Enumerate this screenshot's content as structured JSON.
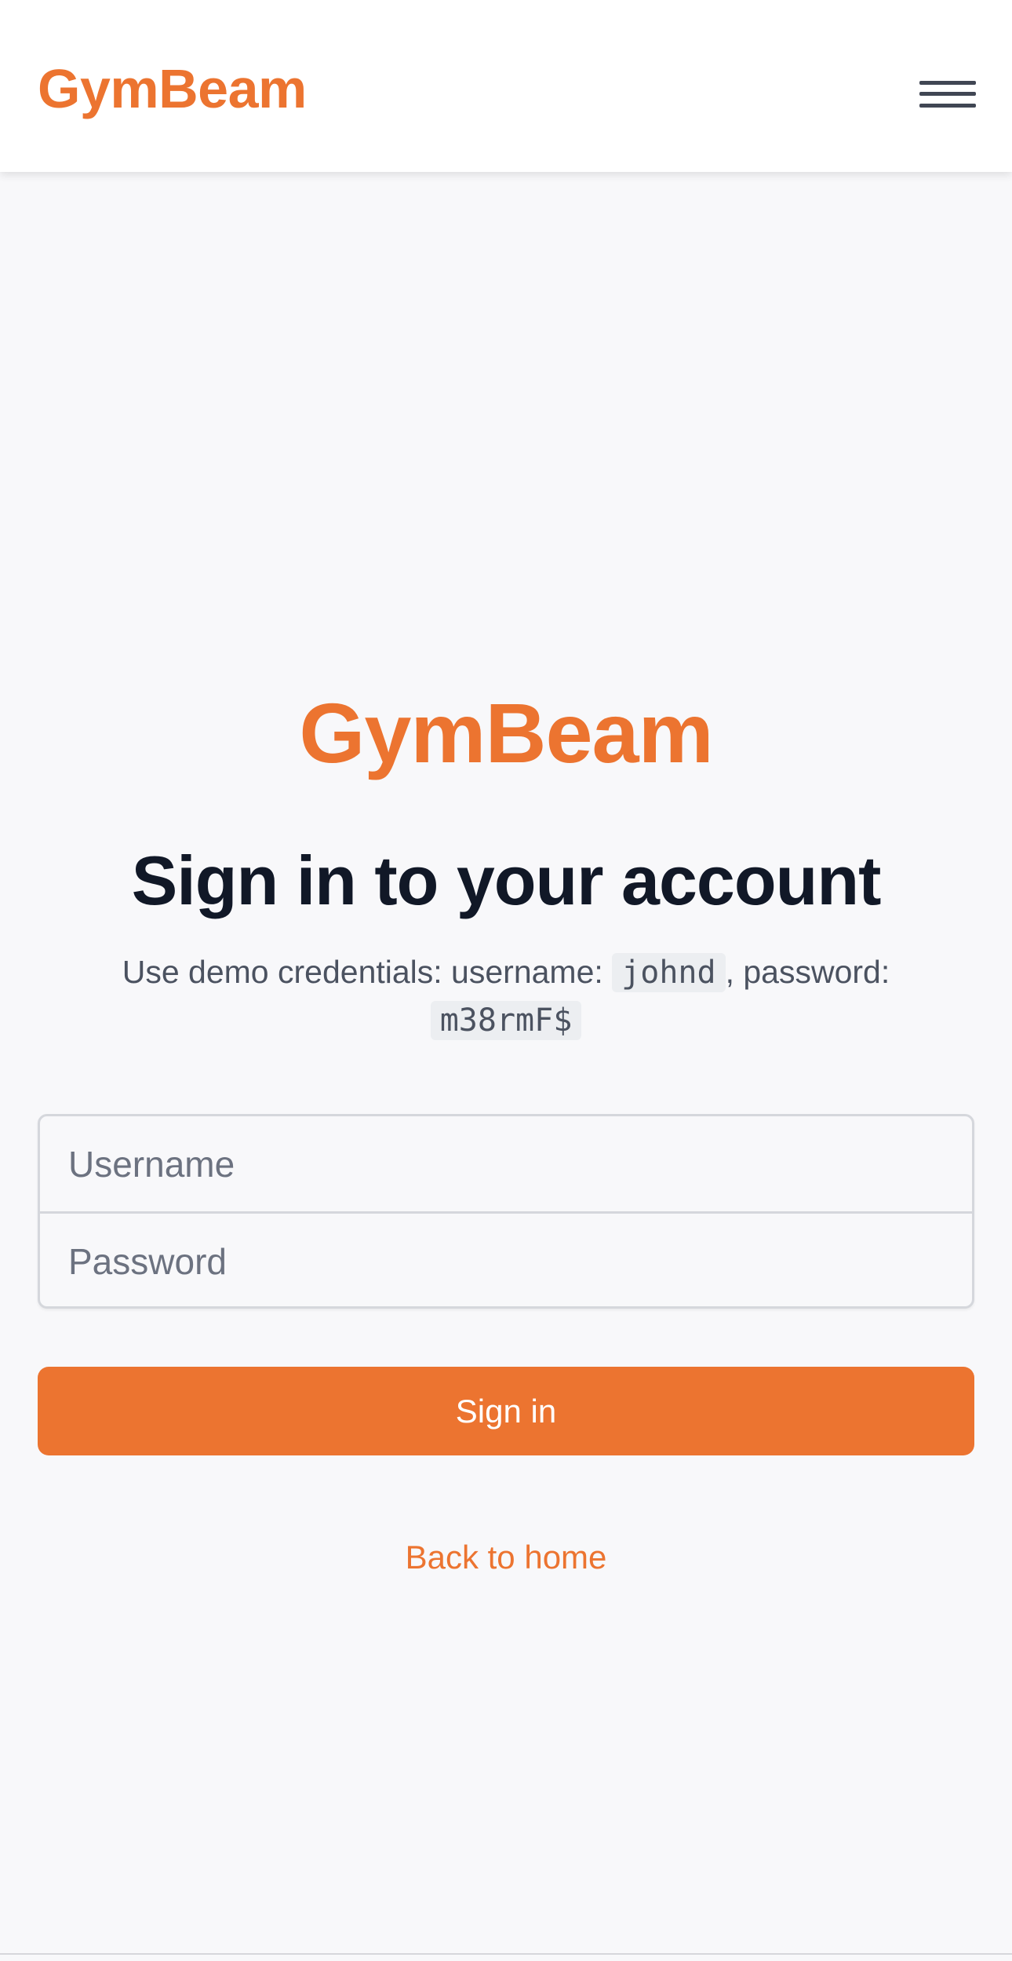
{
  "header": {
    "logo": "GymBeam",
    "menu_icon": "hamburger-menu-icon"
  },
  "login": {
    "brand": "GymBeam",
    "title": "Sign in to your account",
    "hint_prefix": "Use demo credentials: username: ",
    "demo_username": "johnd",
    "hint_middle": ", password: ",
    "demo_password": "m38rmF$",
    "username_placeholder": "Username",
    "password_placeholder": "Password",
    "signin_label": "Sign in",
    "back_link": "Back to home"
  },
  "colors": {
    "brand": "#ec7430",
    "title": "#111827",
    "text_muted": "#4b5260",
    "background": "#f8f8fa",
    "header_bg": "#ffffff"
  }
}
